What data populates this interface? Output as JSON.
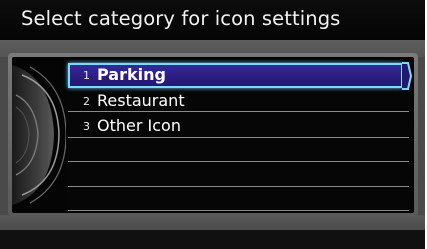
{
  "screen": {
    "title": "Select category for icon settings"
  },
  "menu": {
    "selected_index": 0,
    "items": [
      {
        "number": "1",
        "label": "Parking"
      },
      {
        "number": "2",
        "label": "Restaurant"
      },
      {
        "number": "3",
        "label": "Other Icon"
      }
    ],
    "empty_rows": 4
  },
  "colors": {
    "selection": "#2a1d80",
    "selection_border": "#7fd8ff",
    "background": "#4a4a4a",
    "title_bar": "#0a0a0a",
    "text": "#ffffff"
  }
}
